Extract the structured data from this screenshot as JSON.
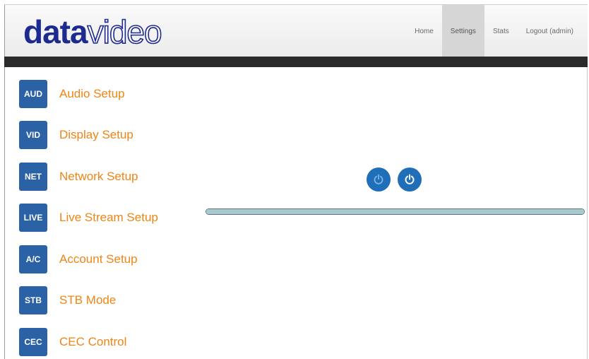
{
  "brand": {
    "part1": "data",
    "part2": "video",
    "color": "#1d2a8f"
  },
  "nav": [
    {
      "label": "Home",
      "active": false
    },
    {
      "label": "Settings",
      "active": true
    },
    {
      "label": "Stats",
      "active": false
    },
    {
      "label": "Logout (admin)",
      "active": false
    }
  ],
  "menu": [
    {
      "badge": "AUD",
      "label": "Audio Setup"
    },
    {
      "badge": "VID",
      "label": "Display Setup"
    },
    {
      "badge": "NET",
      "label": "Network Setup"
    },
    {
      "badge": "LIVE",
      "label": "Live Stream Setup"
    },
    {
      "badge": "A/C",
      "label": "Account Setup"
    },
    {
      "badge": "STB",
      "label": "STB Mode"
    },
    {
      "badge": "CEC",
      "label": "CEC Control"
    }
  ],
  "colors": {
    "accent": "#2a62a5",
    "link": "#ee8514",
    "power": "#1f6fb8"
  },
  "power_buttons": [
    {
      "icon": "power-icon",
      "state": "dim"
    },
    {
      "icon": "power-icon",
      "state": "active"
    }
  ],
  "progress": {
    "fraction": 1.0
  }
}
